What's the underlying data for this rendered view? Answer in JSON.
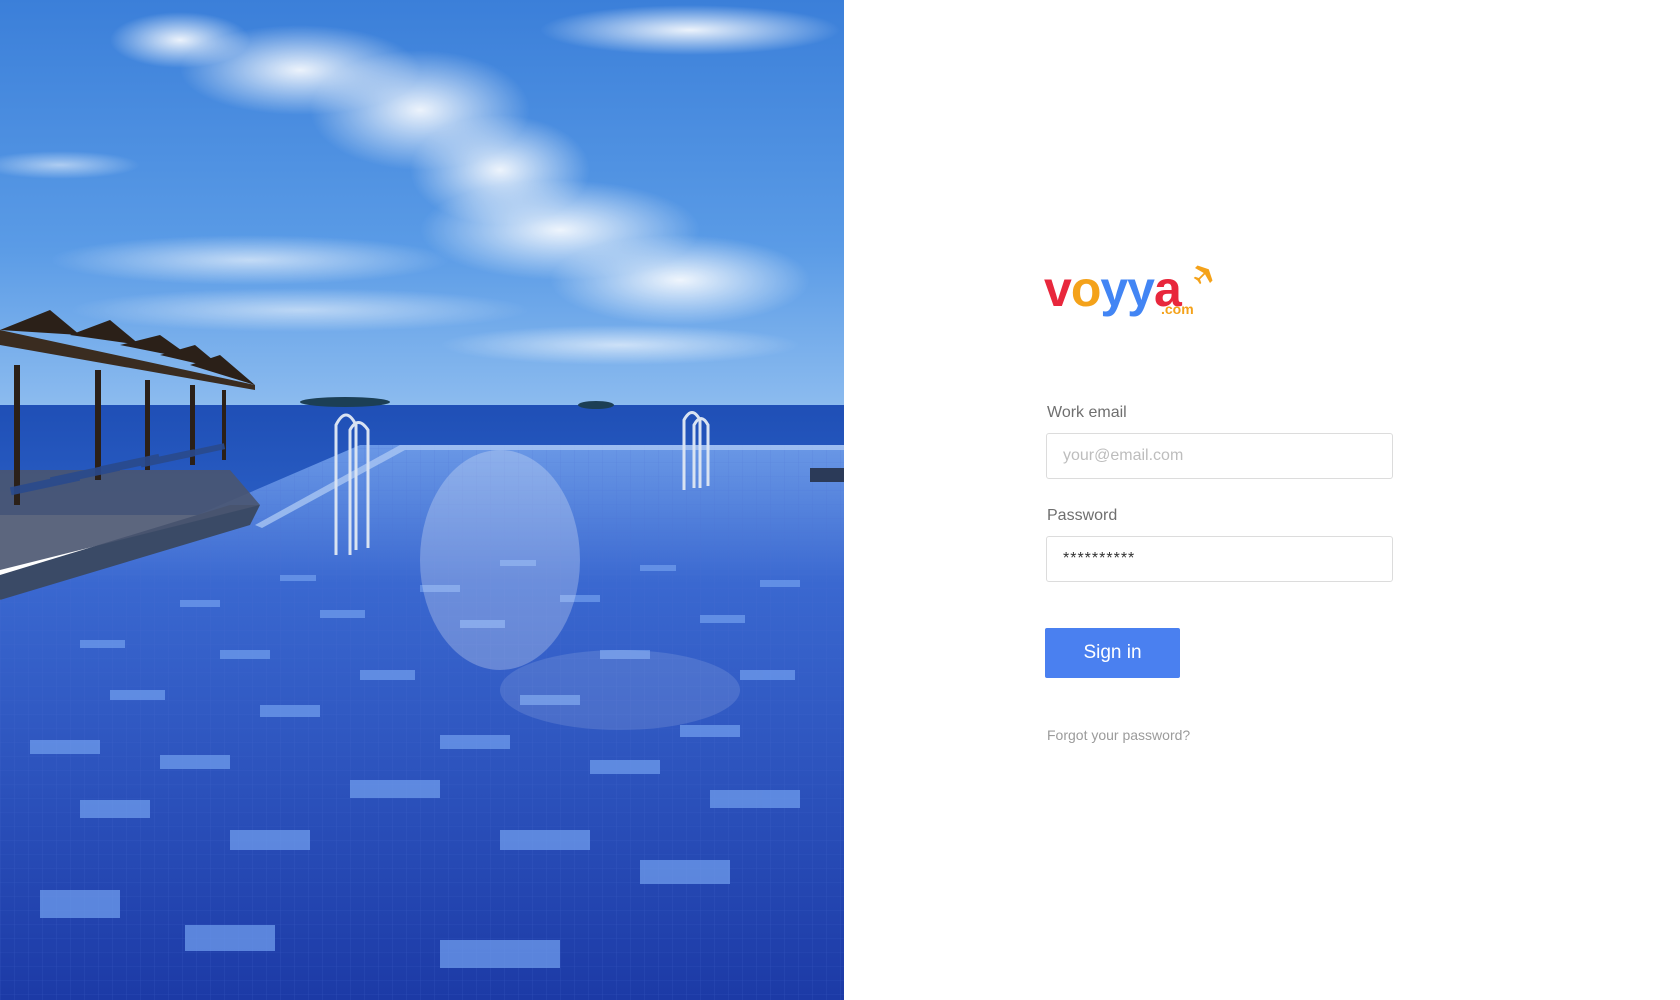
{
  "brand": {
    "logo_letters": [
      "v",
      "o",
      "y",
      "y",
      "a"
    ],
    "logo_colors": [
      "#e8273c",
      "#f4a21a",
      "#4285f4",
      "#4285f4",
      "#e8273c"
    ],
    "logo_suffix": ".com",
    "plane_icon": "airplane-icon",
    "plane_color": "#f4a21a"
  },
  "login": {
    "email_label": "Work email",
    "email_value": "",
    "email_placeholder": "your@email.com",
    "password_label": "Password",
    "password_value": "**********",
    "signin_label": "Sign in",
    "forgot_label": "Forgot your password?",
    "button_color": "#4a80f0"
  },
  "hero": {
    "scene": "hero-photo"
  }
}
